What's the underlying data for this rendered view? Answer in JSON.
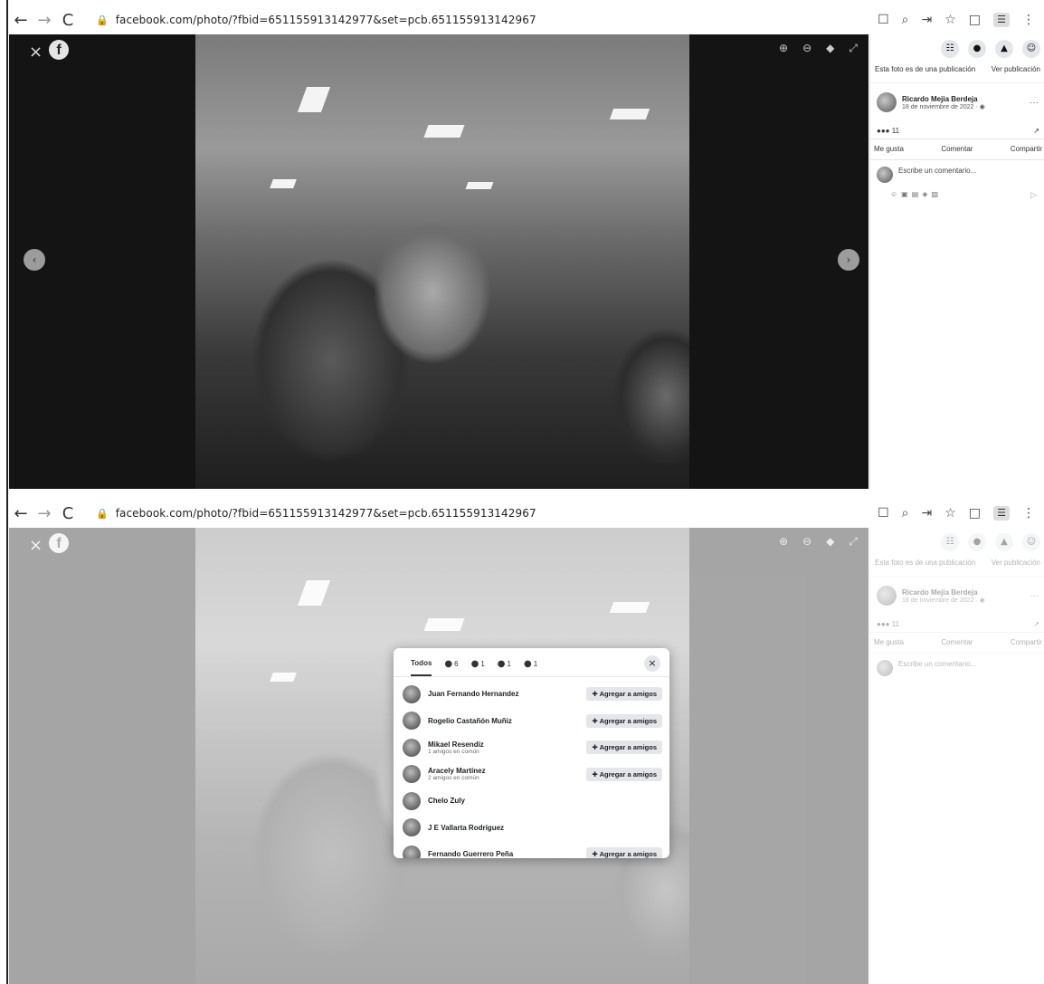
{
  "browser": {
    "back_icon": "←",
    "forward_icon": "→",
    "reload_icon": "C",
    "lock_icon": "🔒",
    "url": "facebook.com/photo/?fbid=651155913142977&set=pcb.651155913142967",
    "right_icons": [
      "☐",
      "⌕",
      "⇥",
      "☆",
      "□",
      "☰",
      "⋮"
    ]
  },
  "viewer": {
    "close_icon": "×",
    "logo_text": "f",
    "tools": [
      "⊕",
      "⊖",
      "◆",
      "⤢"
    ],
    "prev_icon": "‹",
    "next_icon": "›"
  },
  "panel": {
    "top_icons": [
      "☷",
      "●",
      "▲",
      "☺"
    ],
    "post_note": "Esta foto es de una publicación",
    "view_post": "Ver publicación",
    "author_name": "Ricardo Mejia Berdeja",
    "author_date": "18 de noviembre de 2022 · ◉",
    "more": "···",
    "reaction_count": "11",
    "reaction_emojis": "●●●",
    "share_icon": "↗",
    "actions": {
      "like": "Me gusta",
      "comment": "Comentar",
      "share": "Compartir"
    },
    "comment_placeholder": "Escribe un comentario...",
    "comment_tools": [
      "☺",
      "▣",
      "▤",
      "◈",
      "▧"
    ],
    "send_icon": "▷"
  },
  "modal": {
    "tabs": [
      {
        "icon": "",
        "label": "Todos"
      },
      {
        "icon": "●",
        "label": "6"
      },
      {
        "icon": "●",
        "label": "1"
      },
      {
        "icon": "●",
        "label": "1"
      },
      {
        "icon": "●",
        "label": "1"
      }
    ],
    "close_icon": "×",
    "add_icon": "✚",
    "add_label": "Agregar a amigos",
    "people": [
      {
        "name": "Juan Fernando Hernandez",
        "sub": "",
        "add": true
      },
      {
        "name": "Rogelio Castañón Muñiz",
        "sub": "",
        "add": true
      },
      {
        "name": "Mikael Resendiz",
        "sub": "1 amigos en común",
        "add": true
      },
      {
        "name": "Aracely Martínez",
        "sub": "2 amigos en común",
        "add": true
      },
      {
        "name": "Chelo Zuly",
        "sub": "",
        "add": false
      },
      {
        "name": "J E Vallarta Rodríguez",
        "sub": "",
        "add": false
      },
      {
        "name": "Fernando Guerrero Peña",
        "sub": "",
        "add": true
      }
    ]
  }
}
